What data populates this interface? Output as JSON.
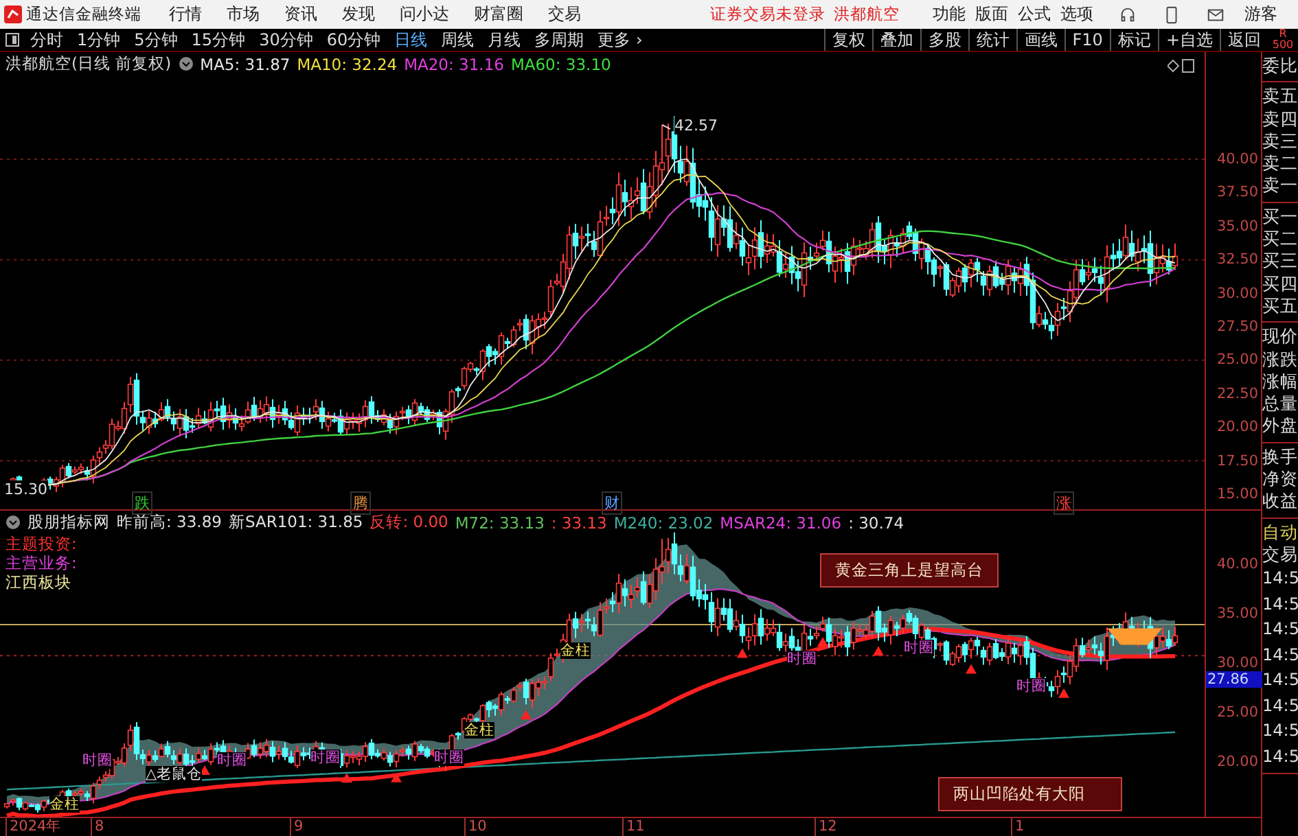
{
  "title_bar": {
    "app_name": "通达信金融终端",
    "menu": [
      "行情",
      "市场",
      "资讯",
      "发现",
      "问小达",
      "财富圈",
      "交易"
    ],
    "notices": [
      "证券交易未登录",
      "洪都航空"
    ],
    "tools": [
      "功能",
      "版面",
      "公式",
      "选项"
    ],
    "user": "游客"
  },
  "period_bar": {
    "periods": [
      {
        "label": "分时",
        "selected": false
      },
      {
        "label": "1分钟",
        "selected": false
      },
      {
        "label": "5分钟",
        "selected": false
      },
      {
        "label": "15分钟",
        "selected": false
      },
      {
        "label": "30分钟",
        "selected": false
      },
      {
        "label": "60分钟",
        "selected": false
      },
      {
        "label": "日线",
        "selected": true
      },
      {
        "label": "周线",
        "selected": false
      },
      {
        "label": "月线",
        "selected": false
      },
      {
        "label": "多周期",
        "selected": false
      },
      {
        "label": "更多 ›",
        "selected": false
      }
    ],
    "actions": [
      "复权",
      "叠加",
      "多股",
      "统计",
      "画线",
      "F10",
      "标记",
      "+自选",
      "返回"
    ],
    "badge": [
      "R",
      "500"
    ]
  },
  "main_chart": {
    "title": "洪都航空(日线 前复权)",
    "indicators": [
      {
        "label": "MA5: 31.87",
        "color": "#e8e8e8"
      },
      {
        "label": "MA10: 32.24",
        "color": "#f0e040"
      },
      {
        "label": "MA20: 31.16",
        "color": "#e040e0"
      },
      {
        "label": "MA60: 33.10",
        "color": "#40e040"
      }
    ],
    "high_label": "42.57",
    "low_label": "15.30",
    "signals": [
      {
        "text": "跌",
        "color": "#30d030"
      },
      {
        "text": "腾",
        "color": "#e09040"
      },
      {
        "text": "财",
        "color": "#5aa0ff"
      },
      {
        "text": "涨",
        "color": "#ff4040"
      }
    ],
    "axis": [
      "40.00",
      "37.50",
      "35.00",
      "32.50",
      "30.00",
      "27.50",
      "25.00",
      "22.50",
      "20.00",
      "17.50",
      "15.00"
    ]
  },
  "sub_chart": {
    "values": [
      {
        "text": "股朋指标网",
        "color": "#e0e0e0"
      },
      {
        "text": "昨前高: 33.89",
        "color": "#e0e0e0"
      },
      {
        "text": "新SAR101: 31.85",
        "color": "#e0e0e0"
      },
      {
        "text": "反转: 0.00",
        "color": "#ff4040"
      },
      {
        "text": "M72: 33.13",
        "color": "#60c060"
      },
      {
        "text": ": 33.13",
        "color": "#ff4040"
      },
      {
        "text": "M240: 23.02",
        "color": "#40b0a0"
      },
      {
        "text": "MSAR24: 31.06",
        "color": "#e040e0"
      },
      {
        "text": ": 30.74",
        "color": "#e0e0e0"
      }
    ],
    "notes": [
      {
        "text": "主题投资:",
        "color": "#ff3030"
      },
      {
        "text": "主营业务:",
        "color": "#e040e0"
      },
      {
        "text": "江西板块",
        "color": "#f0e8a0"
      }
    ],
    "callouts": [
      "黄金三角上是望高台",
      "两山凹陷处有大阳"
    ],
    "marks": [
      {
        "kind": "gold",
        "text": "金柱"
      },
      {
        "kind": "gold",
        "text": "金柱"
      },
      {
        "kind": "gold",
        "text": "金柱"
      },
      {
        "kind": "plain",
        "text": "△老鼠仓"
      },
      {
        "kind": "ring",
        "text": "时圈"
      },
      {
        "kind": "ring",
        "text": "时圈"
      },
      {
        "kind": "ring",
        "text": "时圈"
      },
      {
        "kind": "ring",
        "text": "时圈"
      },
      {
        "kind": "ring",
        "text": "时圈"
      },
      {
        "kind": "ring",
        "text": "时圈"
      },
      {
        "kind": "ring",
        "text": "时圈"
      }
    ],
    "axis": [
      "40.00",
      "35.00",
      "30.00",
      "25.00",
      "20.00"
    ],
    "price_tag": "27.86"
  },
  "date_axis": [
    "2024年",
    "8",
    "9",
    "10",
    "11",
    "12",
    "1"
  ],
  "quote_panel": {
    "groups": [
      {
        "items": [
          {
            "text": "委比",
            "kind": "plain"
          }
        ]
      },
      {
        "items": [
          {
            "text": "卖五",
            "kind": "plain"
          },
          {
            "text": "卖四",
            "kind": "plain"
          },
          {
            "text": "卖三",
            "kind": "plain"
          },
          {
            "text": "卖二",
            "kind": "plain"
          },
          {
            "text": "卖一",
            "kind": "plain"
          }
        ]
      },
      {
        "items": [
          {
            "text": "买一",
            "kind": "plain"
          },
          {
            "text": "买二",
            "kind": "plain"
          },
          {
            "text": "买三",
            "kind": "plain"
          },
          {
            "text": "买四",
            "kind": "plain"
          },
          {
            "text": "买五",
            "kind": "plain"
          }
        ]
      },
      {
        "items": [
          {
            "text": "现价",
            "kind": "plain"
          },
          {
            "text": "涨跌",
            "kind": "plain"
          },
          {
            "text": "涨幅",
            "kind": "plain"
          },
          {
            "text": "总量",
            "kind": "plain"
          },
          {
            "text": "外盘",
            "kind": "plain"
          }
        ]
      },
      {
        "items": [
          {
            "text": "换手",
            "kind": "plain"
          },
          {
            "text": "净资",
            "kind": "plain"
          },
          {
            "text": "收益",
            "kind": "plain"
          }
        ]
      },
      {
        "items": [
          {
            "text": "自动",
            "kind": "highlight"
          },
          {
            "text": "交易",
            "kind": "plain"
          },
          {
            "text": "14:5",
            "kind": "time"
          },
          {
            "text": "14:5",
            "kind": "time"
          },
          {
            "text": "14:5",
            "kind": "time"
          },
          {
            "text": "14:5",
            "kind": "time"
          },
          {
            "text": "14:5",
            "kind": "time"
          },
          {
            "text": "14:5",
            "kind": "time"
          },
          {
            "text": "14:5",
            "kind": "time"
          },
          {
            "text": "14:5",
            "kind": "time"
          }
        ]
      }
    ]
  }
}
